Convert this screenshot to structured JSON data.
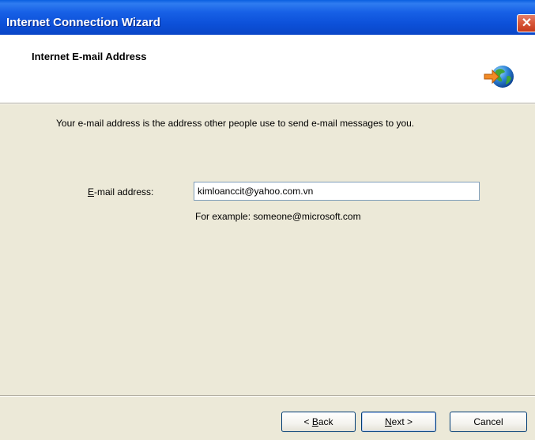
{
  "window": {
    "title": "Internet Connection Wizard",
    "close_symbol": "✕"
  },
  "header": {
    "title": "Internet E-mail Address",
    "icon": "globe-arrow-icon"
  },
  "content": {
    "intro_text": "Your e-mail address is the address other people use to send e-mail messages to you.",
    "email_label_mnemonic": "E",
    "email_label_rest": "-mail address:",
    "email_value": "kimloanccit@yahoo.com.vn",
    "example_text": "For example: someone@microsoft.com"
  },
  "buttons": {
    "back_prefix": "< ",
    "back_mnemonic": "B",
    "back_rest": "ack",
    "next_mnemonic": "N",
    "next_rest": "ext >",
    "cancel": "Cancel"
  },
  "colors": {
    "titlebar": "#0a52d6",
    "dialog_bg": "#ece9d8",
    "close_button": "#d9593c"
  }
}
